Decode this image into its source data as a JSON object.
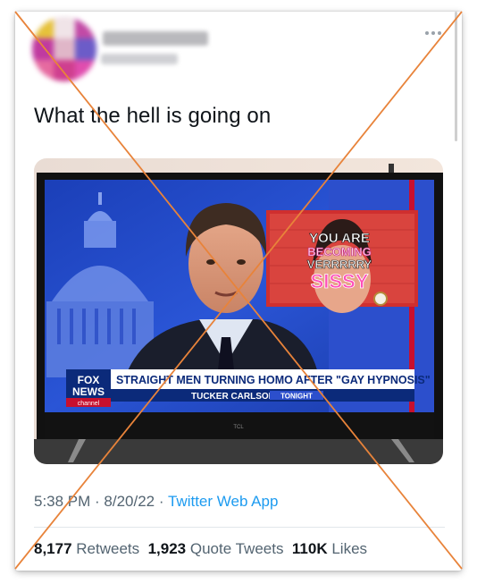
{
  "tweet": {
    "text": "What the hell is going on",
    "time": "5:38 PM",
    "sep1": " · ",
    "date": "8/20/22",
    "sep2": " · ",
    "app": "Twitter Web App"
  },
  "stats": {
    "retweets_count": "8,177",
    "retweets_label": " Retweets",
    "quotes_count": "1,923",
    "quotes_label": " Quote Tweets",
    "likes_count": "110K",
    "likes_label": " Likes"
  },
  "media": {
    "inset_lines": [
      "YOU ARE",
      "BECOMING",
      "VERRRRRY",
      "SISSY"
    ],
    "chyron_headline": "STRAIGHT MEN TURNING HOMO AFTER \"GAY HYPNOSIS\"",
    "chyron_sub": "TUCKER CARLSON",
    "chyron_tag": "TONIGHT",
    "logo_line1": "FOX",
    "logo_line2": "NEWS",
    "logo_line3": "channel",
    "tv_brand": "TCL"
  },
  "colors": {
    "text_primary": "#0f1419",
    "text_secondary": "#536471",
    "link": "#1d9bf0",
    "cross": "#e8833a",
    "fox_blue": "#0b2a7a",
    "chyron_red": "#c8102e"
  }
}
